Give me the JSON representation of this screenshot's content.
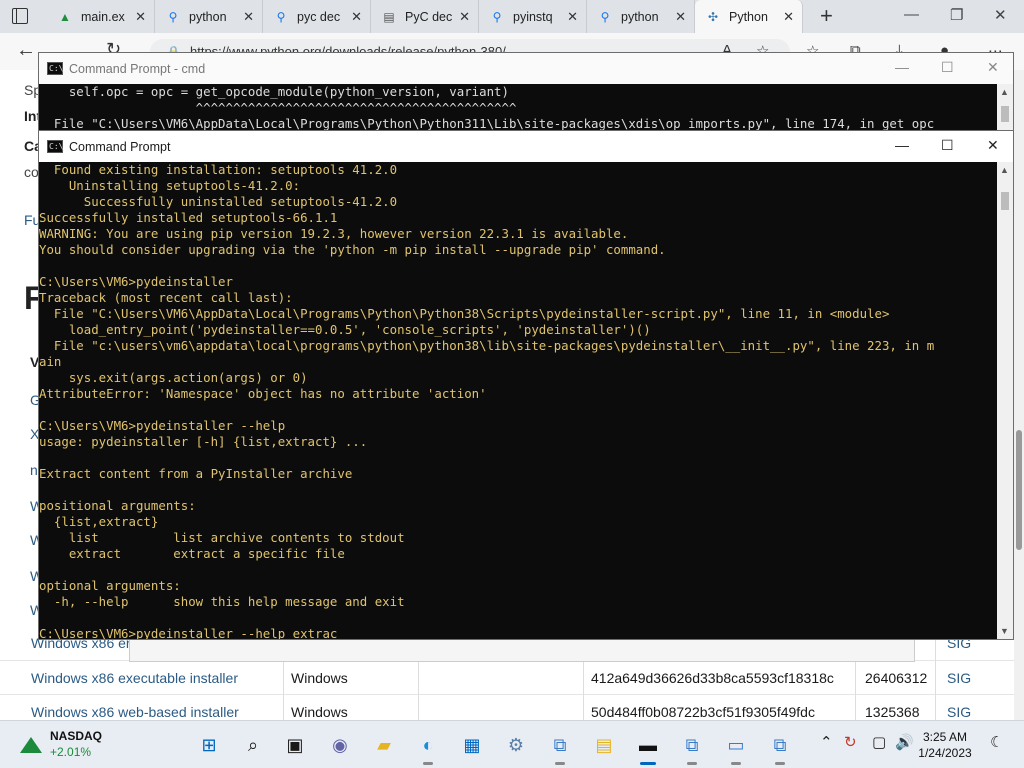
{
  "browser": {
    "tabs": [
      {
        "label": "main.ex",
        "icon": "drive-icon"
      },
      {
        "label": "python",
        "icon": "search-icon"
      },
      {
        "label": "pyc dec",
        "icon": "search-icon"
      },
      {
        "label": "PyC dec",
        "icon": "page-icon"
      },
      {
        "label": "pyinstq",
        "icon": "search-icon"
      },
      {
        "label": "python",
        "icon": "search-icon"
      },
      {
        "label": "Python",
        "icon": "python-icon",
        "active": true
      }
    ],
    "url": "https://www.python.org/downloads/release/python-380/"
  },
  "page": {
    "fragments": [
      "Sp",
      "Int",
      "Ca",
      "co",
      "Fu",
      "F",
      "Vain",
      "G",
      "X",
      "n",
      "W",
      "W",
      "W",
      "W"
    ],
    "rows": [
      {
        "name": "Windows x86 er",
        "os": "",
        "md5": "",
        "size": "",
        "sig": "SIG"
      },
      {
        "name": "Windows x86 executable installer",
        "os": "Windows",
        "md5": "412a649d36626d33b8ca5593cf18318c",
        "size": "26406312",
        "sig": "SIG"
      },
      {
        "name": "Windows x86 web-based installer",
        "os": "Windows",
        "md5": "50d484ff0b08722b3cf51f9305f49fdc",
        "size": "1325368",
        "sig": "SIG"
      }
    ]
  },
  "cmd_back": {
    "title": "Command Prompt - cmd",
    "lines": [
      "    self.opc = opc = get_opcode_module(python_version, variant)",
      "                     ^^^^^^^^^^^^^^^^^^^^^^^^^^^^^^^^^^^^^^^^^^^",
      "  File \"C:\\Users\\VM6\\AppData\\Local\\Programs\\Python\\Python311\\Lib\\site-packages\\xdis\\op_imports.py\", line 174, in get_opc"
    ]
  },
  "cmd_front": {
    "title": "Command Prompt",
    "lines": [
      "  Found existing installation: setuptools 41.2.0",
      "    Uninstalling setuptools-41.2.0:",
      "      Successfully uninstalled setuptools-41.2.0",
      "Successfully installed setuptools-66.1.1",
      "WARNING: You are using pip version 19.2.3, however version 22.3.1 is available.",
      "You should consider upgrading via the 'python -m pip install --upgrade pip' command.",
      "",
      "C:\\Users\\VM6>pydeinstaller",
      "Traceback (most recent call last):",
      "  File \"C:\\Users\\VM6\\AppData\\Local\\Programs\\Python\\Python38\\Scripts\\pydeinstaller-script.py\", line 11, in <module>",
      "    load_entry_point('pydeinstaller==0.0.5', 'console_scripts', 'pydeinstaller')()",
      "  File \"c:\\users\\vm6\\appdata\\local\\programs\\python\\python38\\lib\\site-packages\\pydeinstaller\\__init__.py\", line 223, in m",
      "ain",
      "    sys.exit(args.action(args) or 0)",
      "AttributeError: 'Namespace' object has no attribute 'action'",
      "",
      "C:\\Users\\VM6>pydeinstaller --help",
      "usage: pydeinstaller [-h] {list,extract} ...",
      "",
      "Extract content from a PyInstaller archive",
      "",
      "positional arguments:",
      "  {list,extract}",
      "    list          list archive contents to stdout",
      "    extract       extract a specific file",
      "",
      "optional arguments:",
      "  -h, --help      show this help message and exit",
      "",
      "C:\\Users\\VM6>pydeinstaller --help extrac"
    ]
  },
  "taskbar": {
    "widget_name": "NASDAQ",
    "widget_value": "+2.01%",
    "time": "3:25 AM",
    "date": "1/24/2023"
  },
  "colors": {
    "console_text": "#e0c36e",
    "accent": "#0067c0"
  }
}
